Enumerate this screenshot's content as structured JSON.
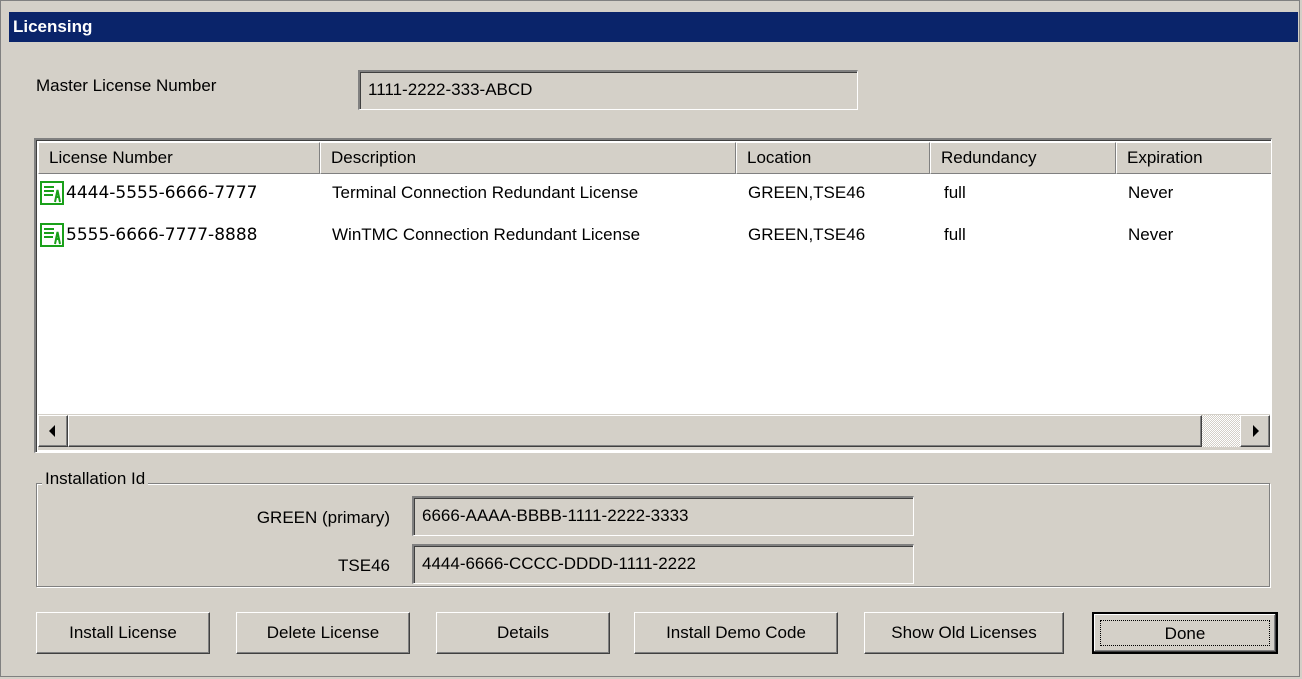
{
  "window": {
    "title": "Licensing"
  },
  "master": {
    "label": "Master License Number",
    "value": "1111-2222-333-ABCD"
  },
  "list": {
    "columns": [
      "License Number",
      "Description",
      "Location",
      "Redundancy",
      "Expiration"
    ],
    "rows": [
      {
        "number": "4444-5555-6666-7777",
        "description": "Terminal Connection Redundant License",
        "location": "GREEN,TSE46",
        "redundancy": "full",
        "expiration": "Never",
        "icon": "license-icon"
      },
      {
        "number": "5555-6666-7777-8888",
        "description": "WinTMC Connection Redundant License",
        "location": "GREEN,TSE46",
        "redundancy": "full",
        "expiration": "Never",
        "icon": "license-icon"
      }
    ]
  },
  "installation": {
    "group_label": "Installation Id",
    "rows": [
      {
        "label": "GREEN (primary)",
        "value": "6666-AAAA-BBBB-1111-2222-3333"
      },
      {
        "label": "TSE46",
        "value": "4444-6666-CCCC-DDDD-1111-2222"
      }
    ]
  },
  "buttons": {
    "install": "Install License",
    "delete": "Delete License",
    "details": "Details",
    "demo": "Install Demo Code",
    "old": "Show Old Licenses",
    "done": "Done"
  },
  "colors": {
    "titlebar": "#0a246a",
    "face": "#d4d0c8",
    "icon_green": "#1aa01a"
  }
}
